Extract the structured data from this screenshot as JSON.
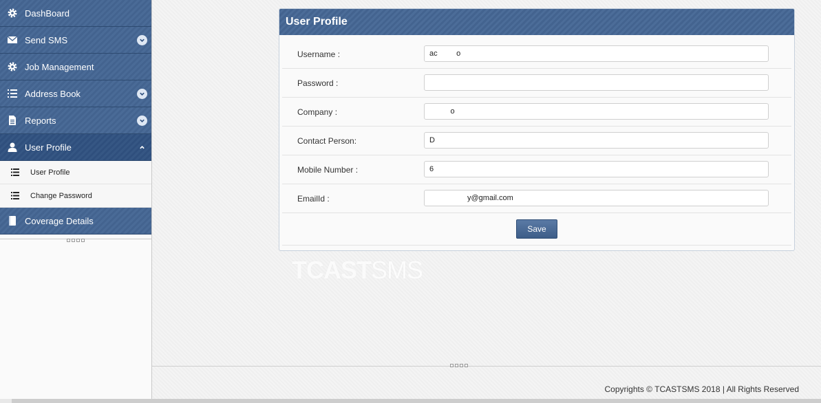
{
  "sidebar": {
    "items": [
      {
        "label": "DashBoard",
        "icon": "gear-icon"
      },
      {
        "label": "Send SMS",
        "icon": "envelope-icon"
      },
      {
        "label": "Job Management",
        "icon": "gear-icon"
      },
      {
        "label": "Address Book",
        "icon": "list-icon"
      },
      {
        "label": "Reports",
        "icon": "document-icon"
      },
      {
        "label": "User Profile",
        "icon": "user-icon"
      }
    ],
    "submenu": [
      {
        "label": "User Profile",
        "icon": "list-icon"
      },
      {
        "label": "Change Password",
        "icon": "list-icon"
      }
    ],
    "coverage": {
      "label": "Coverage Details",
      "icon": "book-icon"
    }
  },
  "profile": {
    "title": "User Profile",
    "fields": [
      {
        "label": "Username :",
        "value": "ac         o"
      },
      {
        "label": "Password :",
        "value": ""
      },
      {
        "label": "Company :",
        "value": "          o"
      },
      {
        "label": "Contact Person:",
        "value": "D"
      },
      {
        "label": "Mobile Number :",
        "value": "6"
      },
      {
        "label": "EmailId :",
        "value": "                  y@gmail.com"
      }
    ],
    "save_label": "Save"
  },
  "watermark": {
    "brand_bold": "TCAST",
    "brand_thin": "SMS"
  },
  "footer": {
    "copyright": "Copyrights © TCASTSMS 2018 | All Rights Reserved"
  },
  "colors": {
    "nav": "#43638f",
    "nav_active": "#2f4f7d",
    "button": "#4a6b97"
  }
}
